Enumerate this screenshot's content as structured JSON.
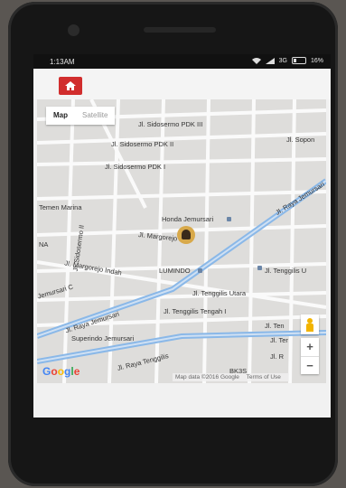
{
  "status_bar": {
    "time": "1:13AM",
    "network": "3G",
    "battery": "16%"
  },
  "map": {
    "type_control": {
      "map_label": "Map",
      "satellite_label": "Satellite"
    },
    "labels": {
      "sidosermo_pdk_iii": "Jl. Sidosermo PDK III",
      "sidosermo_pdk_ii": "Jl. Sidosermo PDK II",
      "sidosermo_pdk_i": "Jl. Sidosermo PDK I",
      "sopon": "Jl. Sopon",
      "raya_jemursari_top": "Jl. Raya Jemursari",
      "honda_jemursari": "Honda Jemursari",
      "margorejo_xix": "Jl. Margorejo XIX",
      "sidosermo_ii": "Jl. Sidosermo II",
      "jemursari_c": "Jemursari C",
      "margorejo_indah": "Jl. Margorejo Indah",
      "lumindo": "LUMINDO",
      "tenggilis_u": "Jl. Tenggilis U",
      "tenggilis_utara": "Jl. Tenggilis Utara",
      "raya_jemursari_bottom": "Jl. Raya Jemursari",
      "tenggilis_tengah_i": "Jl. Tenggilis Tengah I",
      "superindo": "Superindo Jemursari",
      "raya_tenggilis": "Jl. Raya Tenggilis",
      "teman_marina": "Temen Marina",
      "na": "NA",
      "jl_ten": "Jl. Ten",
      "jl_ter": "Jl. Ter",
      "jl_r": "Jl. R",
      "bk3s": "BK3S"
    },
    "google_logo": "Google",
    "attribution": {
      "map_data": "Map data ©2016 Google",
      "terms": "Terms of Use"
    },
    "zoom_in": "+",
    "zoom_out": "−"
  },
  "colors": {
    "home_button": "#d12d2d",
    "major_road": "#8ab8e8",
    "map_bg": "#dedddb"
  }
}
